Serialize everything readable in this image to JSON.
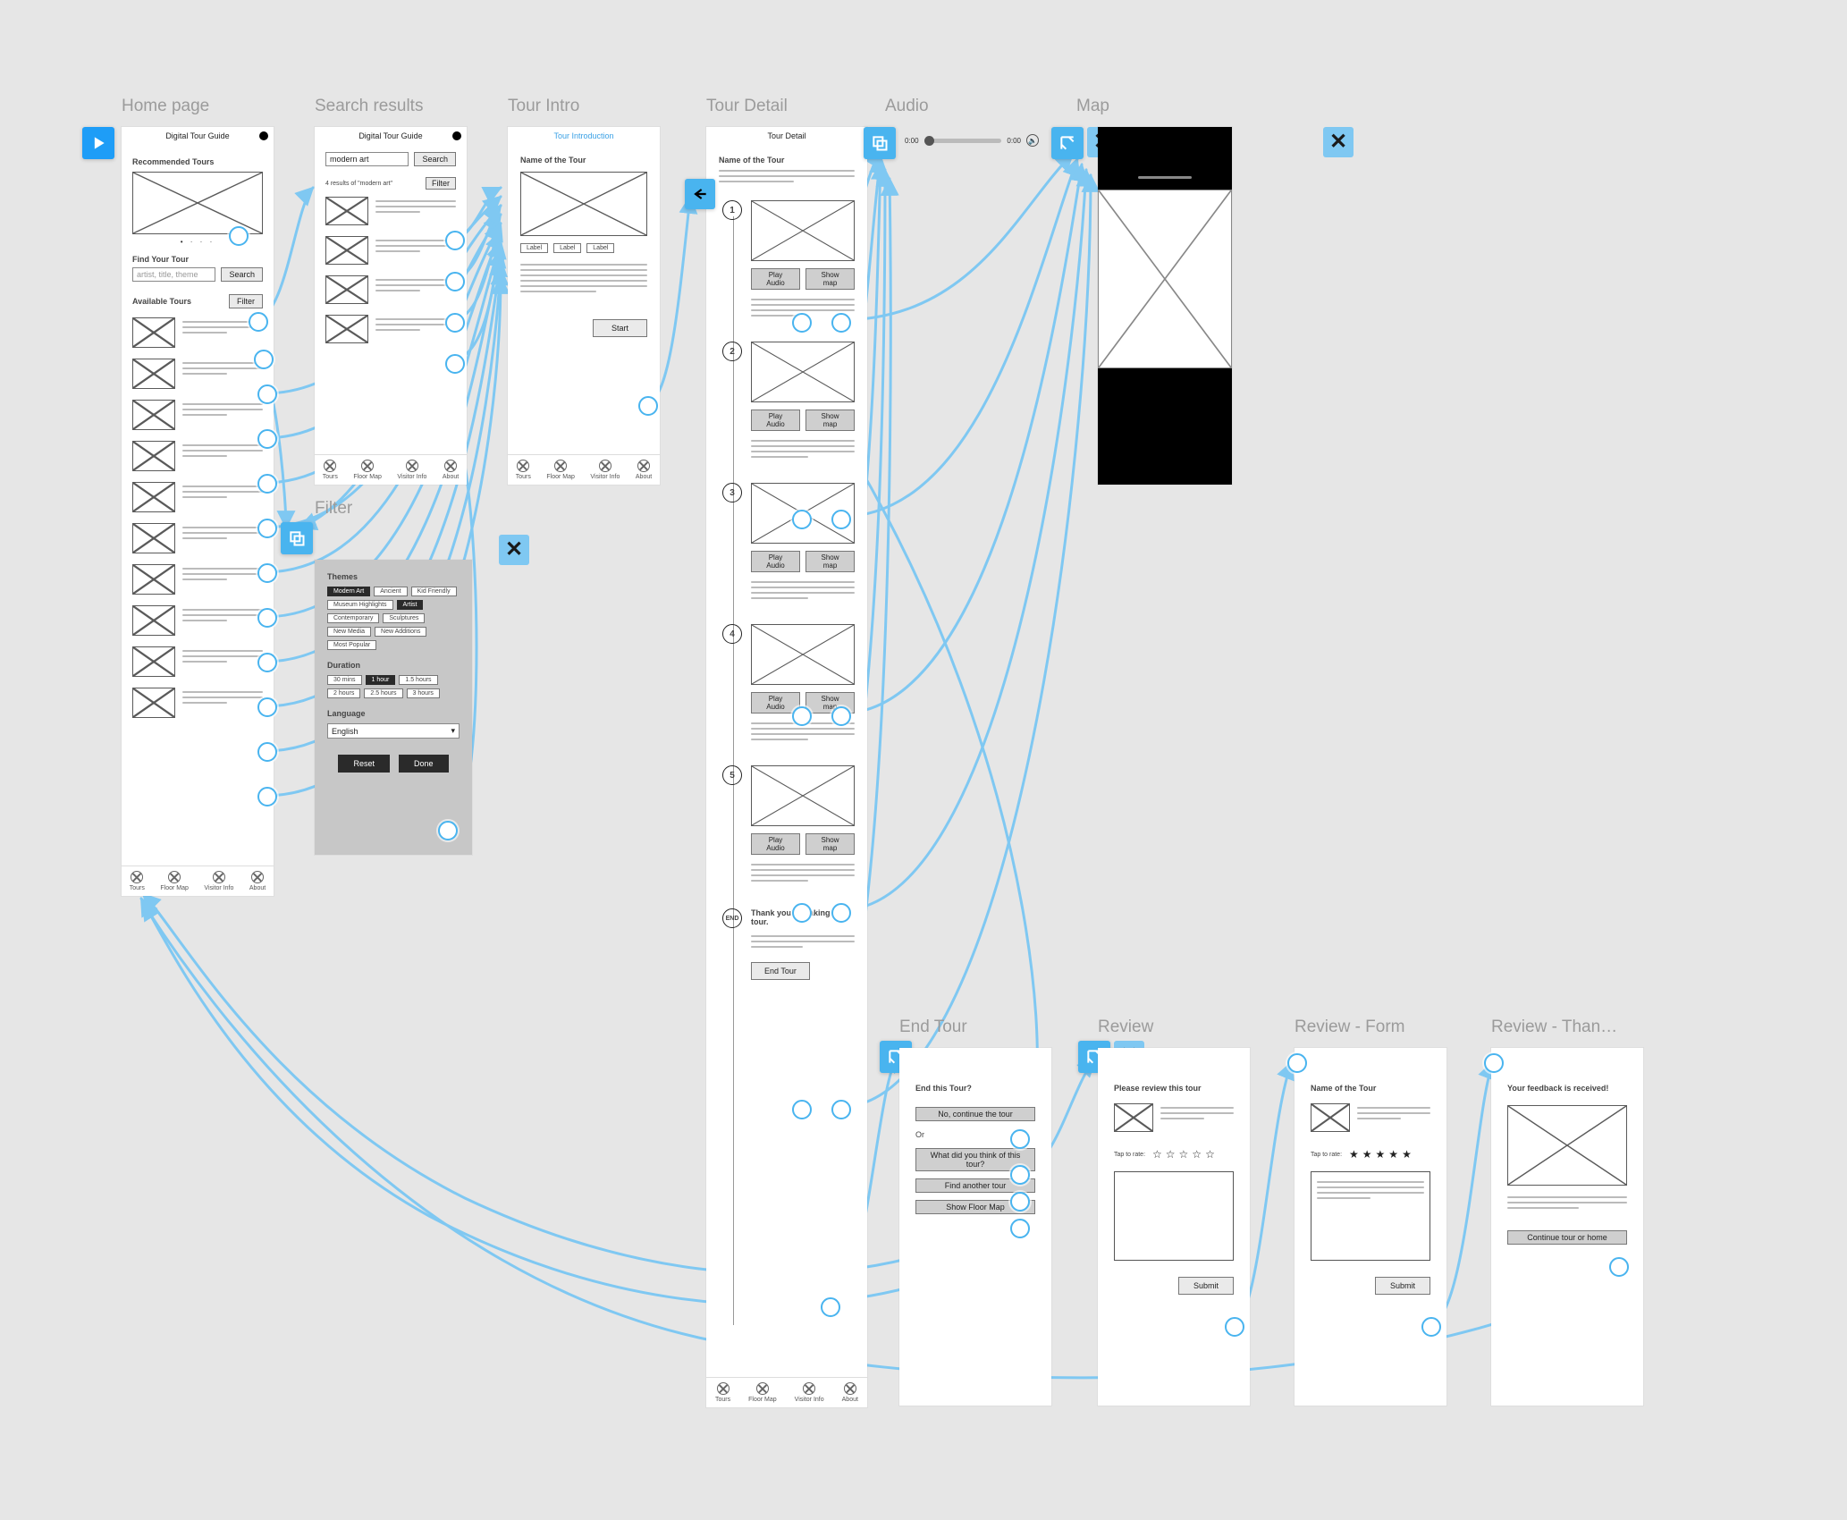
{
  "screens": {
    "home": {
      "label": "Home page"
    },
    "search": {
      "label": "Search results"
    },
    "intro": {
      "label": "Tour Intro"
    },
    "detail": {
      "label": "Tour Detail"
    },
    "audio": {
      "label": "Audio"
    },
    "map": {
      "label": "Map"
    },
    "end": {
      "label": "End Tour"
    },
    "review": {
      "label": "Review"
    },
    "reviewForm": {
      "label": "Review - Form"
    },
    "reviewThanks": {
      "label": "Review - Than…"
    }
  },
  "home": {
    "title": "Digital Tour Guide",
    "recommended": "Recommended Tours",
    "findYourTour": "Find Your Tour",
    "searchPlaceholder": "artist, title, theme",
    "searchBtn": "Search",
    "availableTours": "Available Tours",
    "filterBtn": "Filter"
  },
  "tabs": [
    "Tours",
    "Floor Map",
    "Visitor Info",
    "About"
  ],
  "search": {
    "title": "Digital Tour Guide",
    "query": "modern art",
    "searchBtn": "Search",
    "resultsLine": "4 results of  \"modern art\"",
    "filterBtn": "Filter"
  },
  "filter": {
    "title": "Filter",
    "themesLabel": "Themes",
    "themes": [
      "Modern Art",
      "Ancient",
      "Kid Friendly",
      "Museum Highlights",
      "Artist",
      "Contemporary",
      "Sculptures",
      "New Media",
      "New Additions",
      "Most Popular"
    ],
    "durationLabel": "Duration",
    "durations": [
      "30 mins",
      "1 hour",
      "1.5 hours",
      "2 hours",
      "2.5 hours",
      "3 hours"
    ],
    "languageLabel": "Language",
    "language": "English",
    "reset": "Reset",
    "done": "Done"
  },
  "intro": {
    "crumb": "Tour Introduction",
    "name": "Name of the Tour",
    "tags": [
      "Label",
      "Label",
      "Label"
    ],
    "start": "Start"
  },
  "detail": {
    "title": "Tour Detail",
    "name": "Name of the Tour",
    "playAudio": "Play Audio",
    "showMap": "Show map",
    "endStep": "END",
    "endThanks": "Thank you for taking this tour.",
    "endTourBtn": "End Tour"
  },
  "audio": {
    "t0": "0:00",
    "t1": "0:00"
  },
  "end": {
    "heading": "End this Tour?",
    "no": "No, continue the tour",
    "or": "Or",
    "whatNext": "What did you think of this tour?",
    "findAnother": "Find another tour",
    "floorMap": "Show Floor Map"
  },
  "review": {
    "heading": "Please review this tour",
    "tap": "Tap to rate:",
    "submit": "Submit"
  },
  "reviewForm": {
    "heading": "Name of the Tour",
    "tap": "Tap to rate:",
    "submit": "Submit"
  },
  "reviewThanks": {
    "heading": "Your feedback is received!",
    "cta": "Continue tour or home"
  }
}
